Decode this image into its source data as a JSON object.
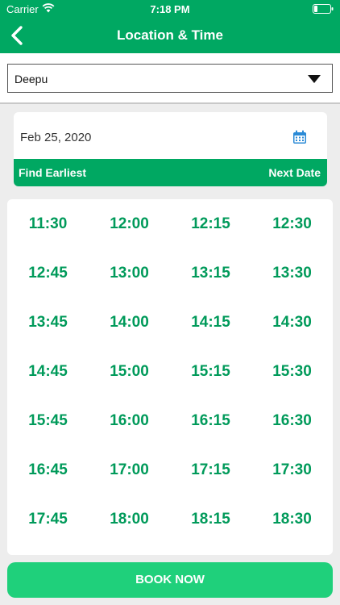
{
  "status_bar": {
    "carrier": "Carrier",
    "time": "7:18 PM"
  },
  "nav": {
    "title": "Location & Time",
    "back_icon": "chevron-left-icon"
  },
  "location": {
    "selected": "Deepu",
    "dropdown_icon": "caret-down-icon"
  },
  "date": {
    "value": "Feb 25, 2020",
    "calendar_icon": "calendar-icon",
    "find_earliest_label": "Find Earliest",
    "next_date_label": "Next Date"
  },
  "time_slots": [
    "11:30",
    "12:00",
    "12:15",
    "12:30",
    "12:45",
    "13:00",
    "13:15",
    "13:30",
    "13:45",
    "14:00",
    "14:15",
    "14:30",
    "14:45",
    "15:00",
    "15:15",
    "15:30",
    "15:45",
    "16:00",
    "16:15",
    "16:30",
    "16:45",
    "17:00",
    "17:15",
    "17:30",
    "17:45",
    "18:00",
    "18:15",
    "18:30"
  ],
  "book_button_label": "BOOK NOW",
  "colors": {
    "primary": "#00a862",
    "button": "#1fd07b",
    "time_text": "#009a5a",
    "background": "#ededed",
    "calendar_icon": "#2a8ad6"
  }
}
